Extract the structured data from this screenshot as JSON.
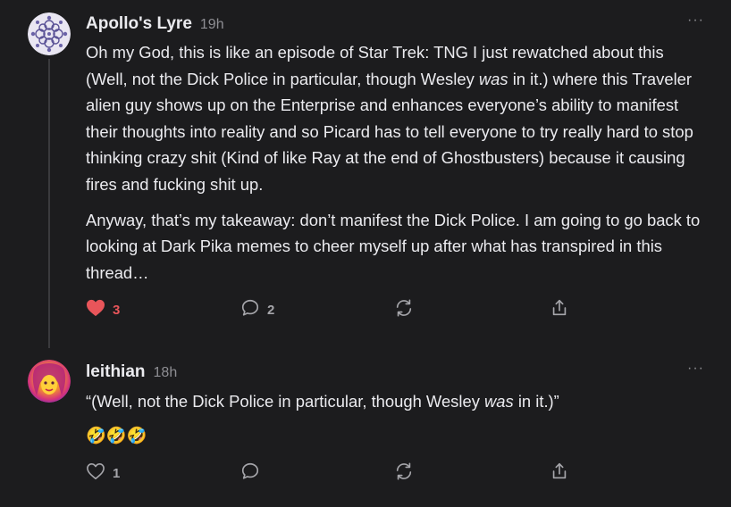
{
  "comments": [
    {
      "author": "Apollo's Lyre",
      "time": "19h",
      "more": "···",
      "paragraphs": [
        {
          "before": "Oh my God, this is like an episode of Star Trek: TNG I just rewatched about this (Well, not the Dick Police in particular, though Wesley ",
          "em": "was",
          "after": " in it.) where this Traveler alien guy shows up on the Enterprise and enhances everyone’s ability to manifest their thoughts into reality and so Picard has to tell everyone to try really hard to stop thinking crazy shit (Kind of like Ray at the end of Ghostbusters) because it causing fires and fucking shit up."
        },
        {
          "text": "Anyway, that’s my takeaway: don’t manifest the Dick Police. I am going to go back to looking at Dark Pika memes to cheer myself up after what has transpired in this thread…"
        }
      ],
      "likes": "3",
      "liked": true,
      "replies": "2",
      "icons": [
        "heart-filled-icon",
        "speech-bubble-icon",
        "restack-icon",
        "share-icon"
      ]
    },
    {
      "author": "leithian",
      "time": "18h",
      "more": "···",
      "quote": {
        "before": "“(Well, not the Dick Police in particular, though Wesley ",
        "em": "was",
        "after": " in it.)”"
      },
      "emojis": "🤣🤣🤣",
      "likes": "1",
      "liked": false,
      "icons": [
        "heart-outline-icon",
        "speech-bubble-icon",
        "restack-icon",
        "share-icon"
      ]
    }
  ],
  "colors": {
    "background": "#1c1c1e",
    "text": "#ebebef",
    "muted": "#8e8e93",
    "like_red": "#e8555a"
  }
}
